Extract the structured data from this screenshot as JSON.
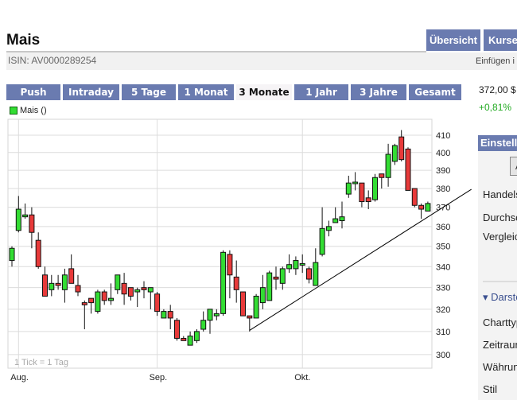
{
  "header": {
    "title": "Mais",
    "isin": "ISIN: AV0000289254",
    "insert_label": "Einfügen i"
  },
  "nav": [
    {
      "label": "Übersicht"
    },
    {
      "label": "Kurse"
    }
  ],
  "tabs": [
    {
      "label": "Push",
      "active": false
    },
    {
      "label": "Intraday",
      "active": false
    },
    {
      "label": "5 Tage",
      "active": false
    },
    {
      "label": "1 Monat",
      "active": false
    },
    {
      "label": "3 Monate",
      "active": true
    },
    {
      "label": "1 Jahr",
      "active": false
    },
    {
      "label": "3 Jahre",
      "active": false
    },
    {
      "label": "Gesamt",
      "active": false
    }
  ],
  "quote": {
    "price": "372,00 $",
    "change": "+0,81%"
  },
  "settings": {
    "header": "Einstellungen",
    "button": "A",
    "labels": [
      "Handelsplatz",
      "Durchschnitt",
      "Vergleich"
    ],
    "section": "▾ Darstellung",
    "options": [
      "Charttyp",
      "Zeitraum",
      "Währung",
      "Stil"
    ]
  },
  "colors": {
    "tab": "#6a7bb0",
    "up": "#33dd33",
    "down": "#e83a3a",
    "change": "#22aa22"
  },
  "chart_data": {
    "type": "candlestick",
    "legend": "Mais ()",
    "note": "1 Tick = 1 Tag",
    "yscale": "log",
    "ylim": [
      296,
      416
    ],
    "yticks": [
      300,
      310,
      320,
      330,
      340,
      350,
      360,
      370,
      380,
      390,
      400,
      410
    ],
    "xticks": [
      {
        "index": 1,
        "label": "Aug."
      },
      {
        "index": 22,
        "label": "Sep."
      },
      {
        "index": 44,
        "label": "Okt."
      }
    ],
    "ohlc": [
      [
        343,
        350,
        340,
        349
      ],
      [
        358,
        376,
        357,
        369
      ],
      [
        365,
        372,
        364,
        366
      ],
      [
        366,
        370,
        349,
        357
      ],
      [
        353,
        357,
        339,
        340
      ],
      [
        336,
        340,
        326,
        326
      ],
      [
        329,
        336,
        326,
        332
      ],
      [
        332,
        336,
        329,
        331
      ],
      [
        329,
        339,
        323,
        336
      ],
      [
        339,
        346,
        332,
        332
      ],
      [
        331,
        336,
        326,
        328
      ],
      [
        323,
        324,
        311,
        322
      ],
      [
        325,
        325,
        318,
        323
      ],
      [
        319,
        329,
        318,
        328
      ],
      [
        328,
        329,
        322,
        324
      ],
      [
        324,
        332,
        322,
        325
      ],
      [
        329,
        336,
        327,
        336
      ],
      [
        332,
        337,
        322,
        327
      ],
      [
        330,
        330,
        324,
        326
      ],
      [
        328,
        330,
        321,
        329
      ],
      [
        330,
        333,
        325,
        329
      ],
      [
        328,
        330,
        320,
        330
      ],
      [
        327,
        328,
        317,
        319
      ],
      [
        316,
        320,
        316,
        319
      ],
      [
        319,
        322,
        311,
        316
      ],
      [
        315,
        316,
        306,
        307
      ],
      [
        307,
        308,
        306,
        306
      ],
      [
        304,
        310,
        304,
        308
      ],
      [
        306,
        311,
        305,
        310
      ],
      [
        311,
        319,
        310,
        315
      ],
      [
        315,
        320,
        309,
        320
      ],
      [
        317,
        320,
        315,
        318
      ],
      [
        318,
        348,
        317,
        347
      ],
      [
        346,
        348,
        325,
        336
      ],
      [
        335,
        343,
        323,
        329
      ],
      [
        328,
        328,
        317,
        317
      ],
      [
        317,
        317,
        310,
        316
      ],
      [
        316,
        327,
        316,
        326
      ],
      [
        323,
        336,
        320,
        330
      ],
      [
        324,
        338,
        324,
        337
      ],
      [
        335,
        340,
        329,
        334
      ],
      [
        332,
        340,
        329,
        339
      ],
      [
        339,
        346,
        337,
        341
      ],
      [
        339,
        345,
        336,
        343
      ],
      [
        341,
        346,
        337,
        341.5
      ],
      [
        339,
        340,
        332,
        334
      ],
      [
        331,
        349,
        331,
        342
      ],
      [
        346,
        370,
        345,
        359
      ],
      [
        358,
        363,
        355,
        360
      ],
      [
        362,
        370,
        362,
        364
      ],
      [
        363,
        373,
        359,
        365
      ],
      [
        377,
        387,
        375,
        383
      ],
      [
        383,
        389,
        379,
        383.5
      ],
      [
        383,
        383,
        370,
        373
      ],
      [
        375,
        379,
        369,
        373
      ],
      [
        374,
        388,
        373,
        386
      ],
      [
        388,
        388,
        380,
        386
      ],
      [
        386,
        405,
        381,
        399
      ],
      [
        395,
        405,
        393,
        404
      ],
      [
        409,
        413,
        395,
        396
      ],
      [
        402,
        403,
        379,
        379
      ],
      [
        380,
        380,
        370,
        371
      ],
      [
        371,
        372,
        364,
        369
      ],
      [
        368,
        373,
        368,
        372
      ]
    ],
    "trendline": [
      [
        36,
        310.5
      ],
      [
        69.6,
        379.6
      ]
    ]
  }
}
